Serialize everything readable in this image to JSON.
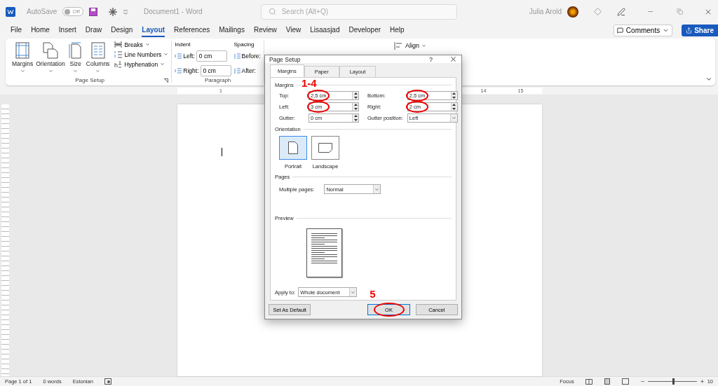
{
  "title_bar": {
    "autosave_label": "AutoSave",
    "autosave_toggle": {
      "label": "Off",
      "on": false
    },
    "document_title": "Document1  -  Word",
    "search": {
      "placeholder": "Search (Alt+Q)"
    },
    "user_name": "Julia Arold"
  },
  "menu_tabs": [
    {
      "label": "File",
      "selected": false
    },
    {
      "label": "Home",
      "selected": false
    },
    {
      "label": "Insert",
      "selected": false
    },
    {
      "label": "Draw",
      "selected": false
    },
    {
      "label": "Design",
      "selected": false
    },
    {
      "label": "Layout",
      "selected": true
    },
    {
      "label": "References",
      "selected": false
    },
    {
      "label": "Mailings",
      "selected": false
    },
    {
      "label": "Review",
      "selected": false
    },
    {
      "label": "View",
      "selected": false
    },
    {
      "label": "Lisaasjad",
      "selected": false
    },
    {
      "label": "Developer",
      "selected": false
    },
    {
      "label": "Help",
      "selected": false
    }
  ],
  "comments_button": "Comments",
  "share_button": "Share",
  "ribbon": {
    "page_setup": {
      "big_buttons": [
        {
          "label": "Margins",
          "kind": "margins"
        },
        {
          "label": "Orientation",
          "kind": "orientation"
        },
        {
          "label": "Size",
          "kind": "size"
        },
        {
          "label": "Columns",
          "kind": "columns"
        }
      ],
      "small_buttons": [
        {
          "label": "Breaks",
          "kind": "breaks"
        },
        {
          "label": "Line Numbers",
          "kind": "numbers"
        },
        {
          "label": "Hyphenation",
          "kind": "hyphen"
        }
      ],
      "group_label": "Page Setup"
    },
    "paragraph": {
      "indent_label": "Indent",
      "indent_fields": [
        {
          "label": "Left:",
          "value": "0 cm"
        },
        {
          "label": "Right:",
          "value": "0 cm"
        }
      ],
      "spacing_label": "Spacing",
      "spacing_fields": [
        "Before:",
        "After:"
      ],
      "group_label": "Paragraph"
    },
    "arrange": {
      "align_button": "Align"
    }
  },
  "ruler": {
    "left_labels": [
      "1"
    ],
    "right_labels": [
      "14",
      "15"
    ]
  },
  "dialog": {
    "title": "Page Setup",
    "help": "?",
    "tabs": [
      {
        "label": "Margins",
        "selected": true
      },
      {
        "label": "Paper",
        "selected": false
      },
      {
        "label": "Layout",
        "selected": false
      }
    ],
    "margins": {
      "label": "Margins",
      "fields": [
        {
          "label": "Top:",
          "value": "2,5 cm",
          "kind": "spin",
          "highlighted": true
        },
        {
          "label": "Bottom:",
          "value": "2,5 cm",
          "kind": "spin",
          "highlighted": true
        },
        {
          "label": "Left:",
          "value": "3 cm",
          "kind": "spin",
          "highlighted": true
        },
        {
          "label": "Right:",
          "value": "2 cm",
          "kind": "spin",
          "highlighted": true
        },
        {
          "label": "Gutter:",
          "value": "0 cm",
          "kind": "spin",
          "highlighted": false
        },
        {
          "label": "Gutter position:",
          "value": "Left",
          "kind": "select",
          "highlighted": false
        }
      ]
    },
    "orientation": {
      "label": "Orientation",
      "options": [
        {
          "label": "Portrait",
          "kind": "portrait",
          "selected": true
        },
        {
          "label": "Landscape",
          "kind": "landscape",
          "selected": false
        }
      ]
    },
    "pages": {
      "label": "Pages",
      "multiple_pages": {
        "label": "Multiple pages:",
        "value": "Normal"
      }
    },
    "preview": {
      "label": "Preview"
    },
    "apply_to": {
      "label": "Apply to:",
      "value": "Whole document"
    },
    "buttons": [
      {
        "label": "Set As Default",
        "kind": "default",
        "highlighted": false
      },
      {
        "label": "OK",
        "kind": "ok",
        "highlighted": true
      },
      {
        "label": "Cancel",
        "kind": "cancel",
        "highlighted": false
      }
    ]
  },
  "annotations": [
    {
      "label": "1-4"
    },
    {
      "label": "5"
    }
  ],
  "status_bar": {
    "page": "Page 1 of 1",
    "words": "0 words",
    "language": "Estonian",
    "focus": "Focus",
    "zoom": {
      "level": 0.5,
      "reading": "10"
    }
  }
}
